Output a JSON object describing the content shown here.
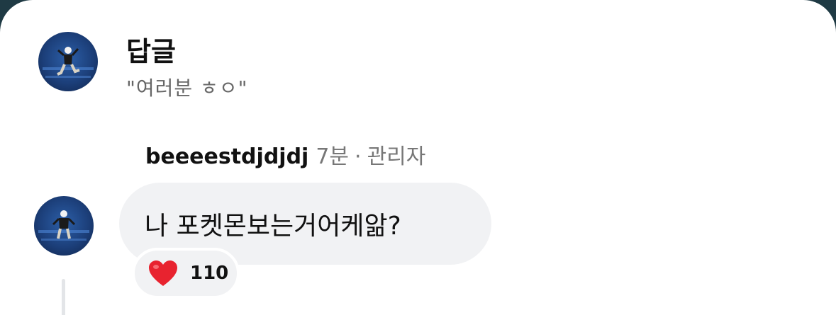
{
  "header": {
    "title": "답글",
    "subtitle": "\"여러분 ㅎㅇ\""
  },
  "comment": {
    "username": "beeeestdjdjdj",
    "time": "7분",
    "separator": "·",
    "role": "관리자",
    "text": "나 포켓몬보는거어케앎?",
    "reaction": {
      "icon": "heart-icon",
      "count": "110",
      "color": "#e8232f"
    }
  },
  "colors": {
    "bubble": "#f1f2f4",
    "frame": "#1f3a44"
  }
}
